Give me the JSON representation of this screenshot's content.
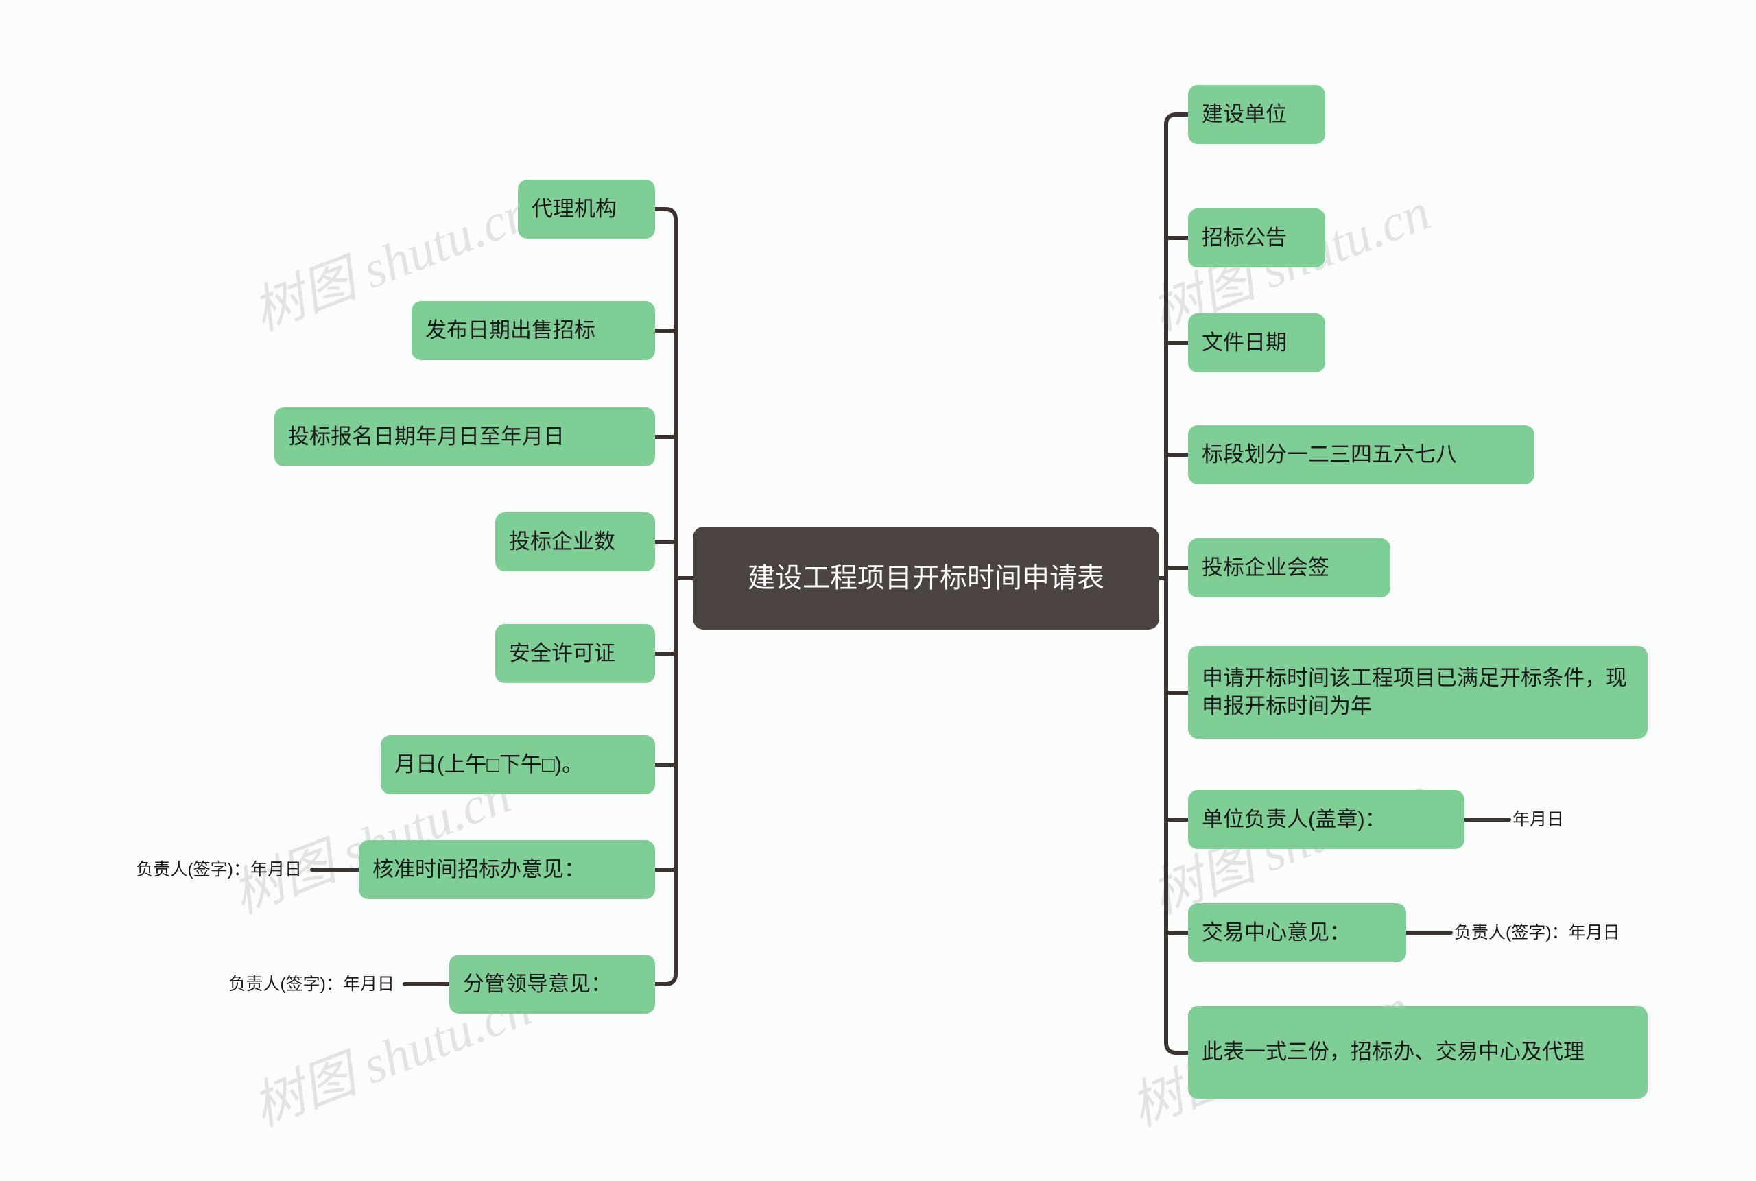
{
  "diagram": {
    "type": "mind-map",
    "title": "建设工程项目开标时间申请表",
    "colors": {
      "root_fill": "#4A433F",
      "root_text": "#FFFFFF",
      "branch_fill": "#7FCE95",
      "branch_text": "#1B1B1B",
      "link_stroke": "#3A3330",
      "background": "#FBFDFD",
      "watermark": "#E2E4E4"
    },
    "watermark_text": "树图 shutu.cn"
  },
  "root": {
    "label": "建设工程项目开标时间申请表"
  },
  "left_branches": [
    {
      "label": "代理机构",
      "children": []
    },
    {
      "label": "发布日期出售招标",
      "children": []
    },
    {
      "label": "投标报名日期年月日至年月日",
      "children": []
    },
    {
      "label": "投标企业数",
      "children": []
    },
    {
      "label": "安全许可证",
      "children": []
    },
    {
      "label": "月日(上午□下午□)。",
      "children": []
    },
    {
      "label": "核准时间招标办意见：",
      "children": [
        {
          "label": "负责人(签字)：年月日"
        }
      ]
    },
    {
      "label": "分管领导意见：",
      "children": [
        {
          "label": "负责人(签字)：年月日"
        }
      ]
    }
  ],
  "right_branches": [
    {
      "label": "建设单位",
      "children": []
    },
    {
      "label": "招标公告",
      "children": []
    },
    {
      "label": "文件日期",
      "children": []
    },
    {
      "label": "标段划分一二三四五六七八",
      "children": []
    },
    {
      "label": "投标企业会签",
      "children": []
    },
    {
      "label": "申请开标时间该工程项目已满足开标条件，现申报开标时间为年",
      "children": []
    },
    {
      "label": "单位负责人(盖章)：",
      "children": [
        {
          "label": "年月日"
        }
      ]
    },
    {
      "label": "交易中心意见：",
      "children": [
        {
          "label": "负责人(签字)：年月日"
        }
      ]
    },
    {
      "label": "此表一式三份，招标办、交易中心及代理",
      "children": []
    }
  ],
  "watermarks": [
    {
      "text": "树图 shutu.cn"
    },
    {
      "text": "树图 shutu.cn"
    },
    {
      "text": "树图 shutu.cn"
    },
    {
      "text": "树图 shutu.cn"
    },
    {
      "text": "树图 shutu.cn"
    },
    {
      "text": "树图 shutu.cn"
    }
  ]
}
